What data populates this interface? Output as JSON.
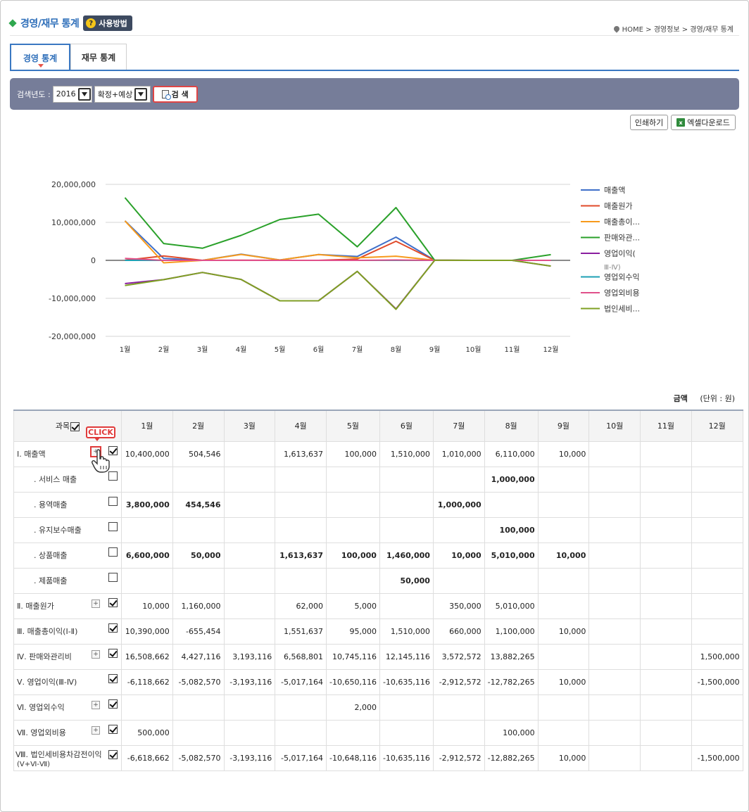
{
  "header": {
    "title": "경영/재무 통계",
    "howto_label": "사용방법",
    "breadcrumb": "HOME > 경영정보 > 경영/재무 통계"
  },
  "tabs": [
    {
      "label": "경영 통계",
      "active": true
    },
    {
      "label": "재무 통계",
      "active": false
    }
  ],
  "search": {
    "label": "검색년도 :",
    "year": "2016",
    "type": "확정+예상",
    "button": "검 색"
  },
  "actions": {
    "print": "인쇄하기",
    "excel": "엑셀다운로드"
  },
  "chart_data": {
    "type": "line",
    "categories": [
      "1월",
      "2월",
      "3월",
      "4월",
      "5월",
      "6월",
      "7월",
      "8월",
      "9월",
      "10월",
      "11월",
      "12월"
    ],
    "ylim": [
      -20000000,
      20000000
    ],
    "yticks": [
      "20,000,000",
      "10,000,000",
      "0",
      "-10,000,000",
      "-20,000,000"
    ],
    "ytick_values": [
      20000000,
      10000000,
      0,
      -10000000,
      -20000000
    ],
    "grid": true,
    "legend_position": "right",
    "series": [
      {
        "name": "매출액",
        "color": "#3e6fc9",
        "values": [
          10400000,
          504546,
          0,
          1613637,
          100000,
          1510000,
          1010000,
          6110000,
          10000,
          0,
          0,
          0
        ]
      },
      {
        "name": "매출원가",
        "color": "#e04a2a",
        "values": [
          10000,
          1160000,
          0,
          62000,
          5000,
          0,
          350000,
          5010000,
          0,
          0,
          0,
          0
        ]
      },
      {
        "name": "매출총이...",
        "color": "#f79a1c",
        "values": [
          10390000,
          -655454,
          0,
          1551637,
          95000,
          1510000,
          660000,
          1100000,
          10000,
          0,
          0,
          0
        ]
      },
      {
        "name": "판매와관...",
        "color": "#2aa12a",
        "values": [
          16508662,
          4427116,
          3193116,
          6568801,
          10745116,
          12145116,
          3572572,
          13882265,
          0,
          0,
          0,
          1500000
        ]
      },
      {
        "name": "영업이익(",
        "name2": "Ⅲ-Ⅳ)",
        "color": "#8a1ea0",
        "values": [
          -6118662,
          -5082570,
          -3193116,
          -5017164,
          -10650116,
          -10635116,
          -2912572,
          -12782265,
          10000,
          0,
          0,
          -1500000
        ]
      },
      {
        "name": "영업외수익",
        "color": "#1ea0b4",
        "values": [
          0,
          0,
          0,
          0,
          2000,
          0,
          0,
          0,
          0,
          0,
          0,
          0
        ]
      },
      {
        "name": "영업외비용",
        "color": "#e0508a",
        "values": [
          500000,
          0,
          0,
          0,
          0,
          0,
          0,
          100000,
          0,
          0,
          0,
          0
        ]
      },
      {
        "name": "법인세비...",
        "color": "#7fa023",
        "values": [
          -6618662,
          -5082570,
          -3193116,
          -5017164,
          -10648116,
          -10635116,
          -2912572,
          -12882265,
          10000,
          0,
          0,
          -1500000
        ]
      }
    ]
  },
  "units": {
    "label": "금액",
    "unit": "(단위 : 원)"
  },
  "table": {
    "subject_header": "과목",
    "months": [
      "1월",
      "2월",
      "3월",
      "4월",
      "5월",
      "6월",
      "7월",
      "8월",
      "9월",
      "10월",
      "11월",
      "12월"
    ],
    "click_label": "CLICK",
    "rows": [
      {
        "label": "Ⅰ. 매출액",
        "sub": false,
        "plus": true,
        "checked": true,
        "bold": false,
        "values": [
          "10,400,000",
          "504,546",
          "",
          "1,613,637",
          "100,000",
          "1,510,000",
          "1,010,000",
          "6,110,000",
          "10,000",
          "",
          "",
          ""
        ]
      },
      {
        "label": ". 서비스 매출",
        "sub": true,
        "plus": false,
        "checked": false,
        "bold": true,
        "values": [
          "",
          "",
          "",
          "",
          "",
          "",
          "",
          "1,000,000",
          "",
          "",
          "",
          ""
        ]
      },
      {
        "label": ". 용역매출",
        "sub": true,
        "plus": false,
        "checked": false,
        "bold": true,
        "values": [
          "3,800,000",
          "454,546",
          "",
          "",
          "",
          "",
          "1,000,000",
          "",
          "",
          "",
          "",
          ""
        ]
      },
      {
        "label": ". 유지보수매출",
        "sub": true,
        "plus": false,
        "checked": false,
        "bold": true,
        "values": [
          "",
          "",
          "",
          "",
          "",
          "",
          "",
          "100,000",
          "",
          "",
          "",
          ""
        ]
      },
      {
        "label": ". 상품매출",
        "sub": true,
        "plus": false,
        "checked": false,
        "bold": true,
        "values": [
          "6,600,000",
          "50,000",
          "",
          "1,613,637",
          "100,000",
          "1,460,000",
          "10,000",
          "5,010,000",
          "10,000",
          "",
          "",
          ""
        ]
      },
      {
        "label": ". 제품매출",
        "sub": true,
        "plus": false,
        "checked": false,
        "bold": true,
        "values": [
          "",
          "",
          "",
          "",
          "",
          "50,000",
          "",
          "",
          "",
          "",
          "",
          ""
        ]
      },
      {
        "label": "Ⅱ. 매출원가",
        "sub": false,
        "plus": true,
        "checked": true,
        "bold": false,
        "values": [
          "10,000",
          "1,160,000",
          "",
          "62,000",
          "5,000",
          "",
          "350,000",
          "5,010,000",
          "",
          "",
          "",
          ""
        ]
      },
      {
        "label": "Ⅲ. 매출총이익(Ⅰ-Ⅱ)",
        "sub": false,
        "plus": false,
        "checked": true,
        "bold": false,
        "values": [
          "10,390,000",
          "-655,454",
          "",
          "1,551,637",
          "95,000",
          "1,510,000",
          "660,000",
          "1,100,000",
          "10,000",
          "",
          "",
          ""
        ]
      },
      {
        "label": "Ⅳ. 판매와관리비",
        "sub": false,
        "plus": true,
        "checked": true,
        "bold": false,
        "values": [
          "16,508,662",
          "4,427,116",
          "3,193,116",
          "6,568,801",
          "10,745,116",
          "12,145,116",
          "3,572,572",
          "13,882,265",
          "",
          "",
          "",
          "1,500,000"
        ]
      },
      {
        "label": "Ⅴ. 영업이익(Ⅲ-Ⅳ)",
        "sub": false,
        "plus": false,
        "checked": true,
        "bold": false,
        "values": [
          "-6,118,662",
          "-5,082,570",
          "-3,193,116",
          "-5,017,164",
          "-10,650,116",
          "-10,635,116",
          "-2,912,572",
          "-12,782,265",
          "10,000",
          "",
          "",
          "-1,500,000"
        ]
      },
      {
        "label": "Ⅵ. 영업외수익",
        "sub": false,
        "plus": true,
        "checked": true,
        "bold": false,
        "values": [
          "",
          "",
          "",
          "",
          "2,000",
          "",
          "",
          "",
          "",
          "",
          "",
          ""
        ]
      },
      {
        "label": "Ⅶ. 영업외비용",
        "sub": false,
        "plus": true,
        "checked": true,
        "bold": false,
        "values": [
          "500,000",
          "",
          "",
          "",
          "",
          "",
          "",
          "100,000",
          "",
          "",
          "",
          ""
        ]
      },
      {
        "label": "Ⅷ. 법인세비용차감전이익",
        "label2": "(Ⅴ+Ⅵ-Ⅶ)",
        "sub": false,
        "plus": false,
        "checked": true,
        "bold": false,
        "values": [
          "-6,618,662",
          "-5,082,570",
          "-3,193,116",
          "-5,017,164",
          "-10,648,116",
          "-10,635,116",
          "-2,912,572",
          "-12,882,265",
          "10,000",
          "",
          "",
          "-1,500,000"
        ]
      }
    ]
  }
}
